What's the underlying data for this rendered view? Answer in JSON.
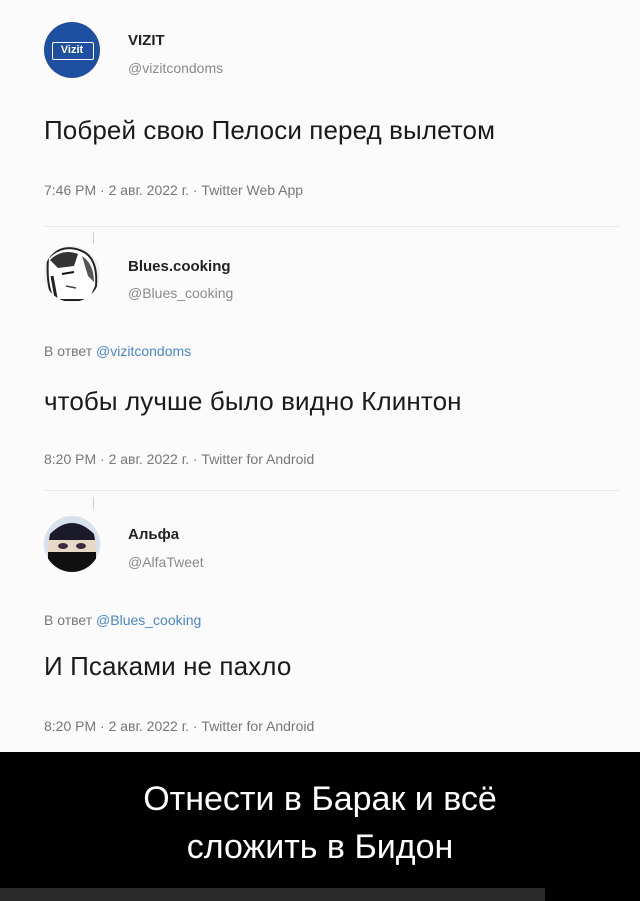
{
  "tweets": [
    {
      "name": "VIZIT",
      "handle": "@vizitcondoms",
      "avatar_text": "Vizit",
      "text": "Побрей свою Пелоси перед вылетом",
      "meta": "7:46 PM · 2 авг. 2022 г. · Twitter Web App"
    },
    {
      "name": "Blues.cooking",
      "handle": "@Blues_cooking",
      "reply_prefix": "В ответ",
      "reply_to": "@vizitcondoms",
      "text": "чтобы лучше было видно Клинтон",
      "meta": "8:20 PM · 2 авг. 2022 г. · Twitter for Android"
    },
    {
      "name": "Альфа",
      "handle": "@AlfaTweet",
      "reply_prefix": "В ответ",
      "reply_to": "@Blues_cooking",
      "text": "И Псаками не пахло",
      "meta": "8:20 PM · 2 авг. 2022 г. · Twitter for Android"
    }
  ],
  "caption": {
    "line1": "Отнести в Барак и всё",
    "line2": "сложить в Бидон"
  },
  "colors": {
    "vizit_blue": "#1e4fa0",
    "link_blue": "#4a86c8",
    "caption_bg": "#000000"
  }
}
